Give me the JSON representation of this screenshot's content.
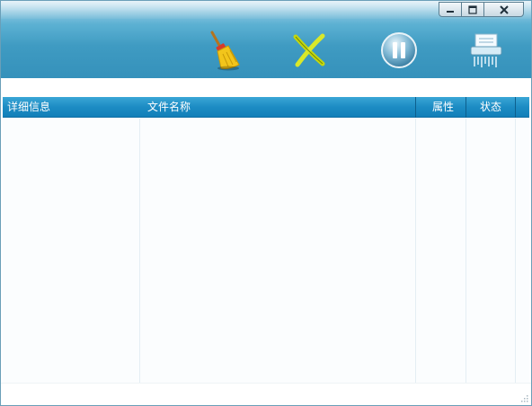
{
  "window": {
    "controls": [
      {
        "name": "minimize",
        "icon": "minimize-icon"
      },
      {
        "name": "maximize",
        "icon": "maximize-icon"
      },
      {
        "name": "close",
        "icon": "close-icon"
      }
    ]
  },
  "toolbar": {
    "buttons": [
      {
        "name": "clean",
        "icon": "broom-icon"
      },
      {
        "name": "delete",
        "icon": "x-mark-icon"
      },
      {
        "name": "pause",
        "icon": "pause-icon"
      },
      {
        "name": "shred",
        "icon": "shredder-icon"
      }
    ]
  },
  "table": {
    "columns": [
      "详细信息",
      "文件名称",
      "属性",
      "状态"
    ],
    "rows": []
  },
  "colors": {
    "header_bg": "#1d8cc4",
    "titlebar_bg": "#3f9bc2",
    "accent": "#127fb9"
  }
}
